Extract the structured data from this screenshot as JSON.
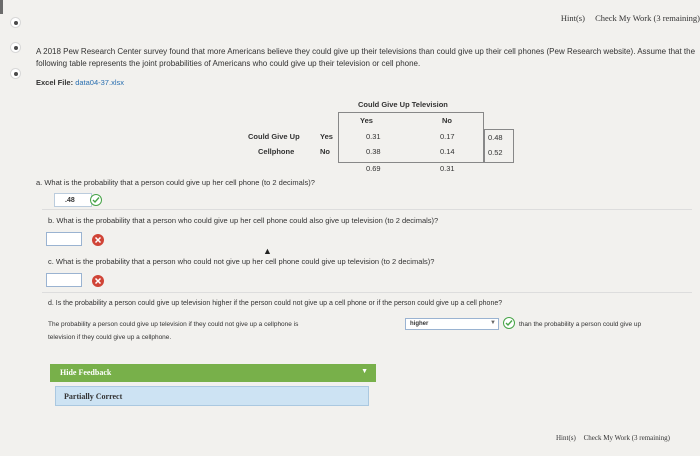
{
  "header": {
    "hints": "Hint(s)",
    "check": "Check My Work",
    "remaining": "(3 remaining)"
  },
  "problem": {
    "intro": "A 2018 Pew Research Center survey found that more Americans believe they could give up their televisions than could give up their cell phones (Pew Research website). Assume that the following table represents the joint probabilities of Americans who could give up their television or cell phone.",
    "excel_label": "Excel File:",
    "excel_file": "data04-37.xlsx"
  },
  "table": {
    "caption": "Could Give Up Television",
    "col_yes": "Yes",
    "col_no": "No",
    "row_header_1": "Could Give Up",
    "row_header_2": "Cellphone",
    "row_yes": "Yes",
    "row_no": "No",
    "r1c1": "0.31",
    "r1c2": "0.17",
    "r1t": "0.48",
    "r2c1": "0.38",
    "r2c2": "0.14",
    "r2t": "0.52",
    "t1": "0.69",
    "t2": "0.31"
  },
  "questions": {
    "a": "a. What is the probability that a person could give up her cell phone (to 2 decimals)?",
    "a_answer": ".48",
    "b": "b. What is the probability that a person who could give up her cell phone could also give up television (to 2 decimals)?",
    "b_answer": "",
    "c": "c. What is the probability that a person who could not give up her cell phone could give up television (to 2 decimals)?",
    "c_answer": "",
    "d": "d. Is the probability a person could give up television higher if the person could not give up a cell phone or if the person could give up a cell phone?",
    "d_text_1": "The probability a person could give up television if they could not give up a cellphone is",
    "d_select": "higher",
    "d_text_2": "than the probability a person could give up",
    "d_text_3": "television if they could give up a cellphone."
  },
  "feedback": {
    "toggle": "Hide Feedback",
    "result": "Partially Correct"
  },
  "footer": {
    "hints": "Hint(s)",
    "check": "Check My Work",
    "remaining": "(3 remaining)"
  }
}
